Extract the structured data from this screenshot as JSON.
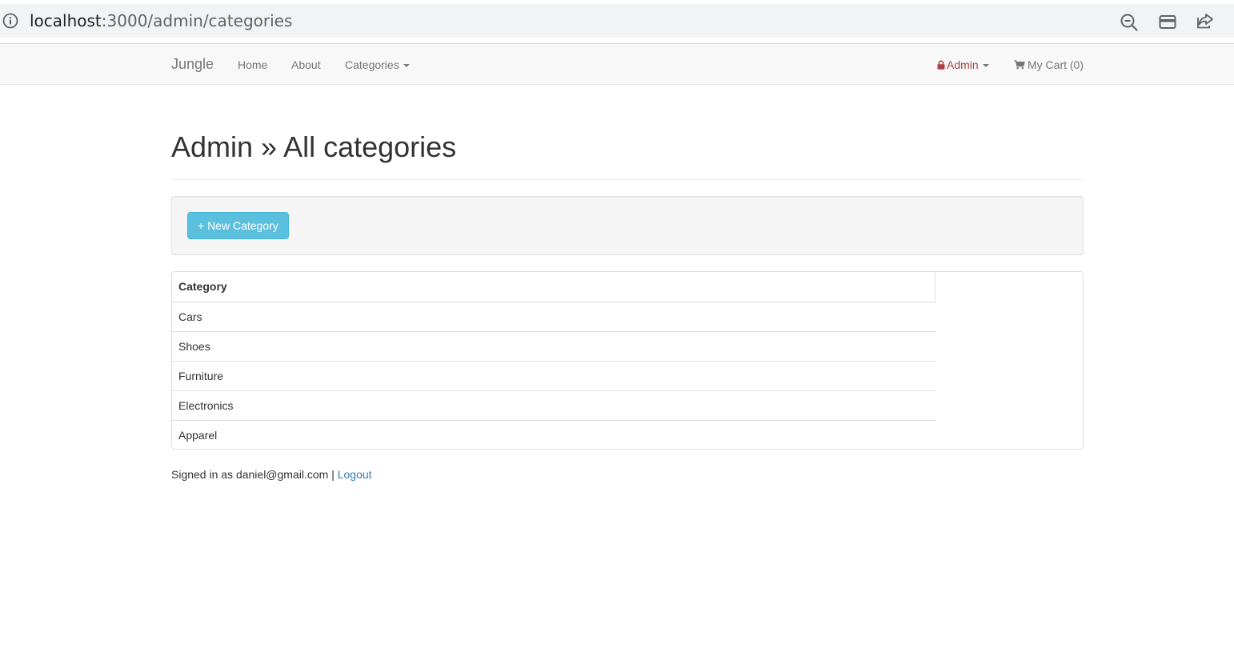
{
  "browser": {
    "url_host": "localhost",
    "url_path": ":3000/admin/categories",
    "icons": [
      "info-icon",
      "zoom-out-icon",
      "card-icon",
      "share-icon"
    ]
  },
  "navbar": {
    "brand": "Jungle",
    "links": {
      "home": "Home",
      "about": "About",
      "categories": "Categories"
    },
    "admin": "Admin",
    "cart": "My Cart (0)"
  },
  "page": {
    "title": "Admin » All categories",
    "new_button": "+ New Category"
  },
  "table": {
    "header": "Category",
    "rows": [
      "Cars",
      "Shoes",
      "Furniture",
      "Electronics",
      "Apparel"
    ]
  },
  "footer": {
    "signed_in_text": "Signed in as daniel@gmail.com |",
    "logout": "Logout"
  },
  "colors": {
    "navbar_bg": "#f8f8f8",
    "admin_red": "#a94442",
    "info_button": "#5bc0de",
    "link_blue": "#337ab7"
  }
}
